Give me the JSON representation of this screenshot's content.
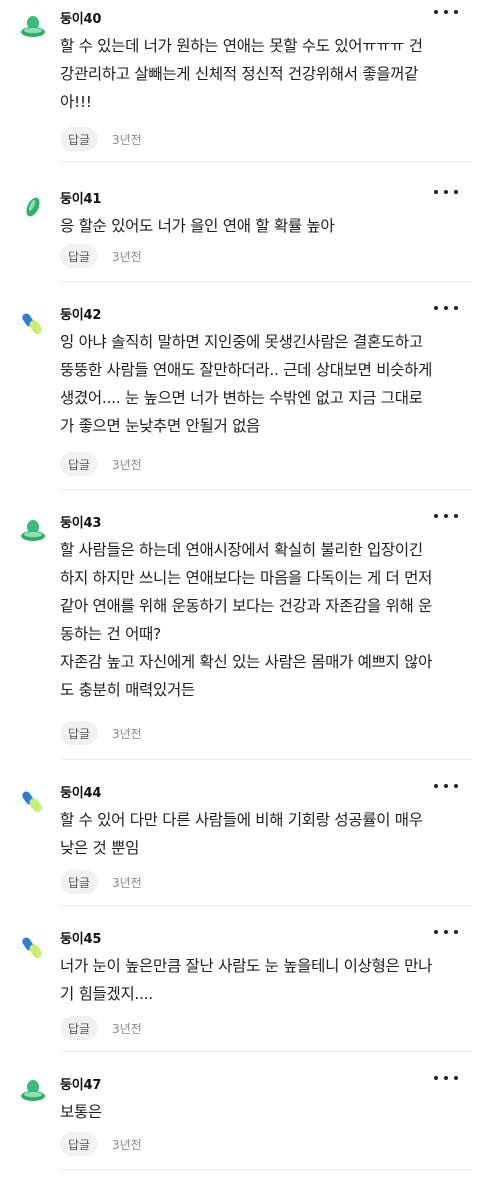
{
  "ui": {
    "reply_label": "답글",
    "more_icon": "more-horizontal-icon"
  },
  "colors": {
    "avatar_green": "#3dbb7a",
    "avatar_green_light": "#8ee0b3",
    "avatar_blue": "#2b7fd6",
    "avatar_lime": "#c8ee7a",
    "divider": "#ececec",
    "reply_bg": "#f1f1f1",
    "time_text": "#8a8a8a"
  },
  "comments": [
    {
      "author": "둥이40",
      "avatar": "green-saucer",
      "lines": [
        "할 수 있는데 너가 원하는 연애는 못할 수도 있어ㅠㅠㅠ 건",
        "강관리하고 살빼는게 신체적 정신적 건강위해서 좋을꺼같",
        "아!!!"
      ],
      "time": "3년전"
    },
    {
      "author": "둥이41",
      "avatar": "green-leaf",
      "lines": [
        "응 할순 있어도 너가 을인 연애 할 확률 높아"
      ],
      "time": "3년전"
    },
    {
      "author": "둥이42",
      "avatar": "blue-lime-pills",
      "lines": [
        "잉 아냐 솔직히 말하면 지인중에 못생긴사람은 결혼도하고",
        "뚱뚱한 사람들 연애도 잘만하더라.. 근데 상대보면 비슷하게",
        "생겼어.... 눈 높으면 너가 변하는 수밖엔 없고 지금 그대로",
        "가 좋으면 눈낮추면 안될거 없음"
      ],
      "time": "3년전"
    },
    {
      "author": "둥이43",
      "avatar": "green-saucer",
      "lines": [
        "할 사람들은 하는데 연애시장에서 확실히 불리한 입장이긴",
        "하지 하지만 쓰니는 연애보다는 마음을 다독이는 게 더 먼저",
        "같아 연애를 위해 운동하기 보다는 건강과 자존감을 위해 운",
        "동하는 건 어때?",
        "자존감 높고 자신에게 확신 있는 사람은 몸매가 예쁘지 않아",
        "도 충분히 매력있거든"
      ],
      "time": "3년전"
    },
    {
      "author": "둥이44",
      "avatar": "blue-lime-pills",
      "lines": [
        "할 수 있어 다만 다른 사람들에 비해 기회랑 성공률이 매우",
        "낮은 것 뿐임"
      ],
      "time": "3년전"
    },
    {
      "author": "둥이45",
      "avatar": "blue-lime-pills",
      "lines": [
        "너가 눈이 높은만큼 잘난 사람도 눈 높을테니 이상형은 만나",
        "기 힘들겠지...."
      ],
      "time": "3년전"
    },
    {
      "author": "둥이47",
      "avatar": "green-saucer",
      "lines": [
        "보통은"
      ],
      "time": "3년전"
    }
  ]
}
